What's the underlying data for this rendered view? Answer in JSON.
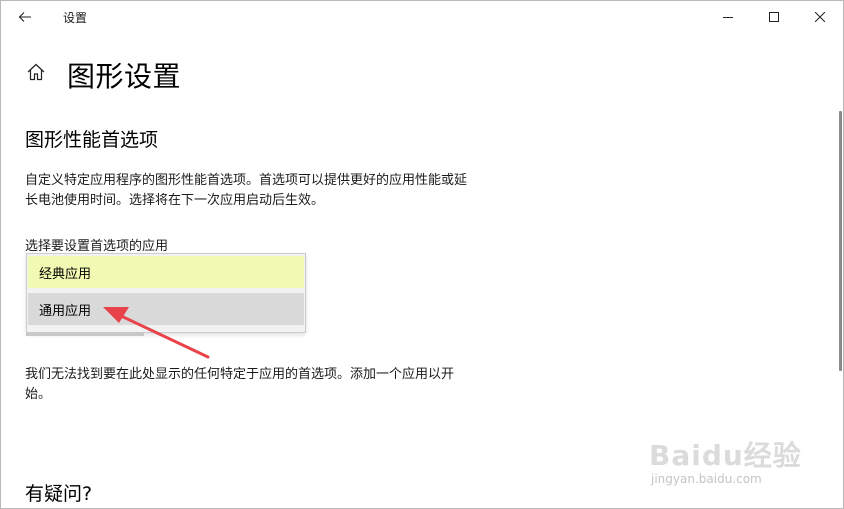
{
  "window": {
    "title": "设置",
    "back_icon": "arrow-left-icon",
    "controls": [
      "minimize-icon",
      "maximize-icon",
      "close-icon"
    ]
  },
  "header": {
    "home_icon": "home-icon",
    "title": "图形设置"
  },
  "section": {
    "heading": "图形性能首选项",
    "description": "自定义特定应用程序的图形性能首选项。首选项可以提供更好的应用性能或延长电池使用时间。选择将在下一次应用启动后生效。"
  },
  "app_selector": {
    "label": "选择要设置首选项的应用",
    "options": [
      {
        "label": "经典应用",
        "state": "hovered"
      },
      {
        "label": "通用应用",
        "state": "selected"
      }
    ]
  },
  "empty_message": "我们无法找到要在此处显示的任何特定于应用的首选项。添加一个应用以开始。",
  "faq": {
    "heading": "有疑问?"
  },
  "watermark": {
    "brand": "Baidu经验",
    "url": "jingyan.baidu.com"
  },
  "colors": {
    "hover_option_bg": "#f1fab2",
    "selected_option_bg": "#d9d9d9",
    "annotation_arrow": "#e8434b"
  }
}
